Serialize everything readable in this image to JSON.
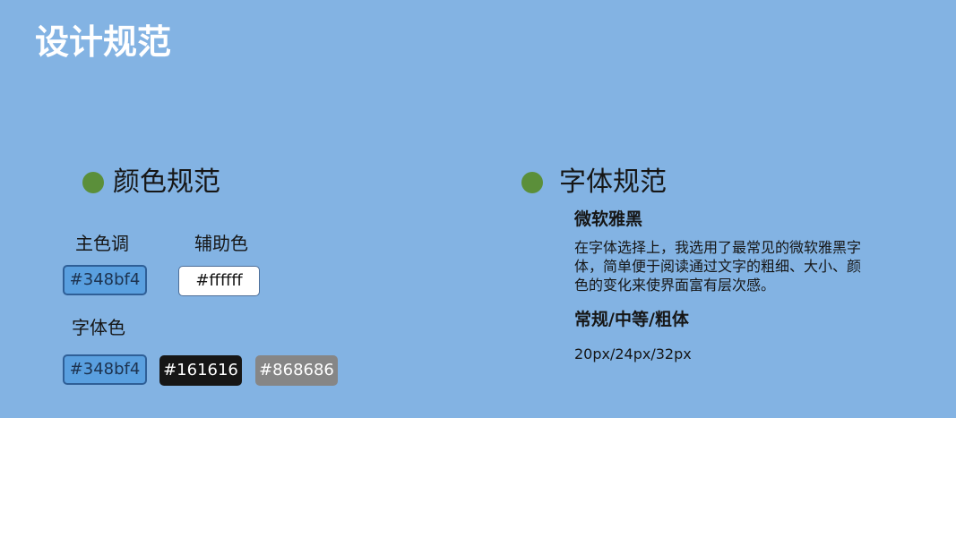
{
  "title": "设计规范",
  "colors_section": {
    "heading": "颜色规范",
    "primary_label": "主色调",
    "primary_value": "#348bf4",
    "secondary_label": "辅助色",
    "secondary_value": "#ffffff",
    "font_color_label": "字体色",
    "font_colors": [
      "#348bf4",
      "#161616",
      "#868686"
    ]
  },
  "font_section": {
    "heading": "字体规范",
    "font_name": "微软雅黑",
    "description": "在字体选择上，我选用了最常见的微软雅黑字体，简单便于阅读通过文字的粗细、大小、颜色的变化来使界面富有层次感。",
    "weights": "常规/中等/粗体",
    "sizes": "20px/24px/32px"
  },
  "colors": {
    "panel_bg": "#83b3e3",
    "bullet": "#5b8f3a",
    "swatch_blue_bg": "#5aa0e0",
    "swatch_blue_border": "#2f5f97",
    "swatch_white_bg": "#ffffff",
    "swatch_black_bg": "#161616",
    "swatch_gray_bg": "#868686"
  }
}
